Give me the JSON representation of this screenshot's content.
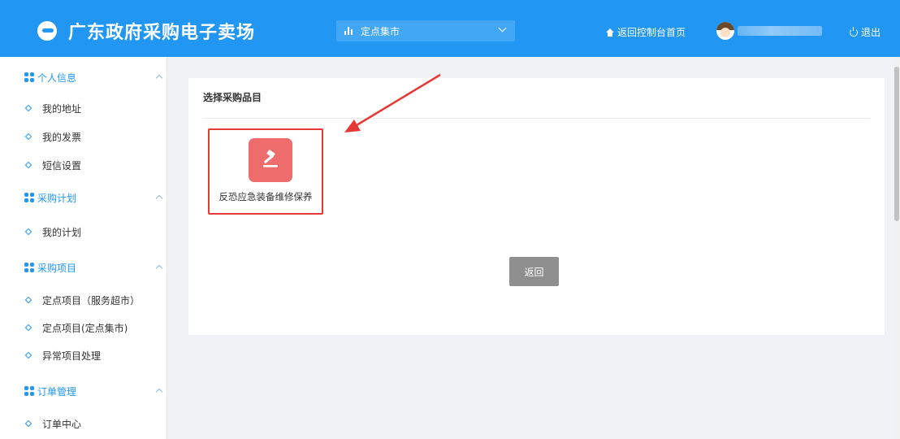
{
  "header": {
    "title": "广东政府采购电子卖场",
    "market_select": {
      "selected": "定点集市",
      "icon": "bar-chart-icon"
    },
    "home_link": "返回控制台首页",
    "logout": "退出"
  },
  "sidebar": {
    "groups": [
      {
        "label": "个人信息",
        "items": [
          "我的地址",
          "我的发票",
          "短信设置"
        ]
      },
      {
        "label": "采购计划",
        "items": [
          "我的计划"
        ]
      },
      {
        "label": "采购项目",
        "items": [
          "定点项目（服务超市）",
          "定点项目(定点集市)",
          "异常项目处理"
        ]
      },
      {
        "label": "订单管理",
        "items": [
          "订单中心"
        ]
      }
    ]
  },
  "main": {
    "panel_title": "选择采购品目",
    "categories": [
      {
        "label": "反恐应急装备维修保养",
        "icon": "gavel-icon"
      }
    ],
    "back_button": "返回"
  },
  "colors": {
    "primary": "#2196f3",
    "card_icon_bg": "#ef6c6c",
    "highlight": "#e53935",
    "button_gray": "#8f8f8f"
  }
}
